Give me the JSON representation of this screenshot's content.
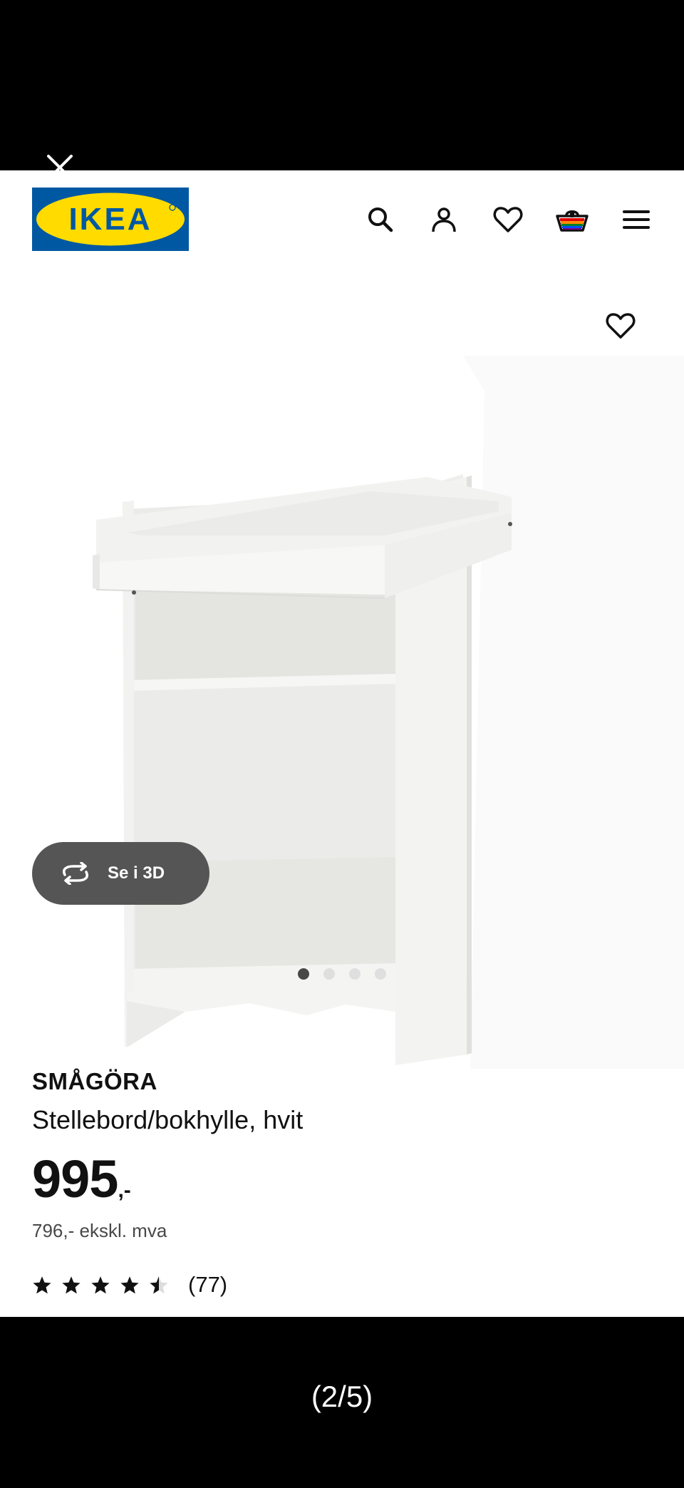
{
  "viewer": {
    "counter": "(2/5)"
  },
  "header": {
    "logo_text": "IKEA",
    "icons": [
      "search-icon",
      "user-icon",
      "heart-icon",
      "cart-icon",
      "menu-icon"
    ]
  },
  "gallery": {
    "view3d_label": "Se i 3D",
    "dots_total": 4,
    "dots_active": 1
  },
  "product": {
    "name": "SMÅGÖRA",
    "description": "Stellebord/bokhylle, hvit",
    "price": "995",
    "price_suffix": ",-",
    "price_ex_vat": "796,- ekskl. mva",
    "rating_value": 4.5,
    "reviews_count": "(77)"
  },
  "colors": {
    "ikea_blue": "#0058a3",
    "ikea_yellow": "#ffdb00",
    "button_dark": "#555555"
  }
}
